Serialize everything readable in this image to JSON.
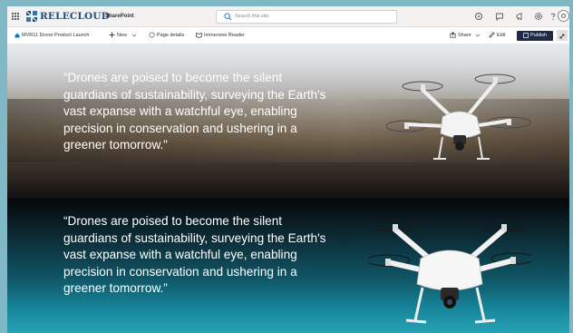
{
  "suite_bar": {
    "brand": "RELECLOUD",
    "app_name": "SharePoint",
    "search_placeholder": "Search this site"
  },
  "command_bar": {
    "page_name": "MVR11 Drone Product Launch",
    "new_label": "New",
    "page_details_label": "Page details",
    "immersive_reader_label": "Immersive Reader",
    "share_label": "Share",
    "edit_label": "Edit",
    "publish_label": "Publish"
  },
  "hero": {
    "quote_top": "“Drones are poised to become the silent guardians of sustainability, surveying the Earth's vast expanse with a watchful eye, enabling precision in conservation and ushering in a greener tomorrow.”",
    "quote_bottom": "“Drones are poised to become the silent guardians of sustainability, surveying the Earth's vast expanse with a watchful eye, enabling precision in conservation and ushering in a greener tomorrow.”"
  },
  "colors": {
    "publish_button": "#1f2a44",
    "brand_text": "#1f4e79"
  }
}
